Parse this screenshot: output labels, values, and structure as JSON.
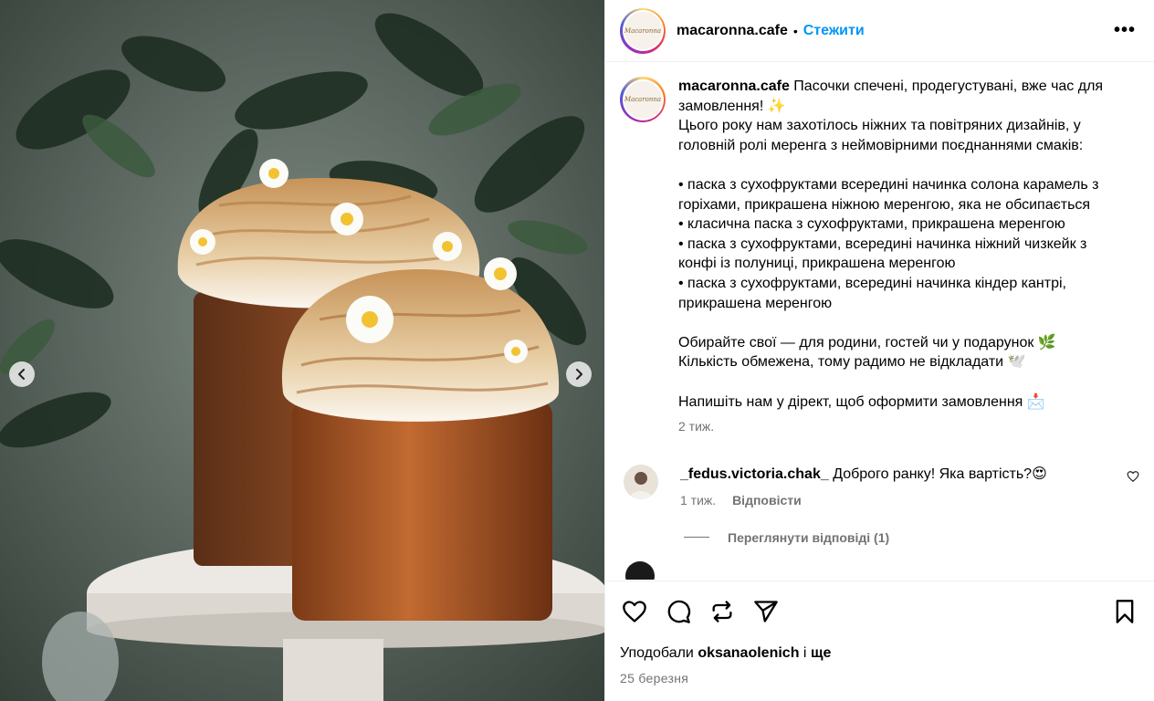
{
  "post": {
    "username": "macaronna.cafe",
    "follow_label": "Стежити",
    "separator": "•",
    "more_label": "•••",
    "avatar_text": "Macaronna",
    "caption": "Пасочки спечені, продегустувані, вже час для замовлення! ✨\nЦього року нам захотілось ніжних та повітряних дизайнів, у головній ролі меренга з неймовірними поєднаннями смаків:\n\n• паска з сухофруктами всередині начинка солона карамель з горіхами, прикрашена ніжною меренгою, яка не обсипається\n• класична паска з сухофруктами, прикрашена меренгою\n• паска з сухофруктами, всередині начинка ніжний чизкейк з конфі із полуниці, прикрашена меренгою\n• паска з сухофруктами, всередині начинка кіндер кантрі, прикрашена меренгою\n\nОбирайте свої — для родини, гостей чи у подарунок 🌿\nКількість обмежена, тому радимо не відкладати 🕊️\n\nНапишіть нам у дірект, щоб оформити замовлення 📩",
    "caption_time": "2 тиж."
  },
  "comments": [
    {
      "username": "_fedus.victoria.chak_",
      "text": "Доброго ранку! Яка вартість?😍",
      "time": "1 тиж.",
      "reply_label": "Відповісти",
      "view_replies": "Переглянути відповіді (1)"
    }
  ],
  "actions": {
    "liked_by_prefix": "Уподобали",
    "liked_by_user": "oksanaolenich",
    "liked_by_suffix": "і",
    "liked_by_more": "ще",
    "date": "25 березня"
  },
  "colors": {
    "accent": "#0095f6",
    "muted": "#737373",
    "divider": "#efefef"
  },
  "icons": [
    "chevron-left-icon",
    "chevron-right-icon",
    "heart-icon",
    "comment-icon",
    "repost-icon",
    "share-icon",
    "bookmark-icon",
    "more-icon"
  ]
}
